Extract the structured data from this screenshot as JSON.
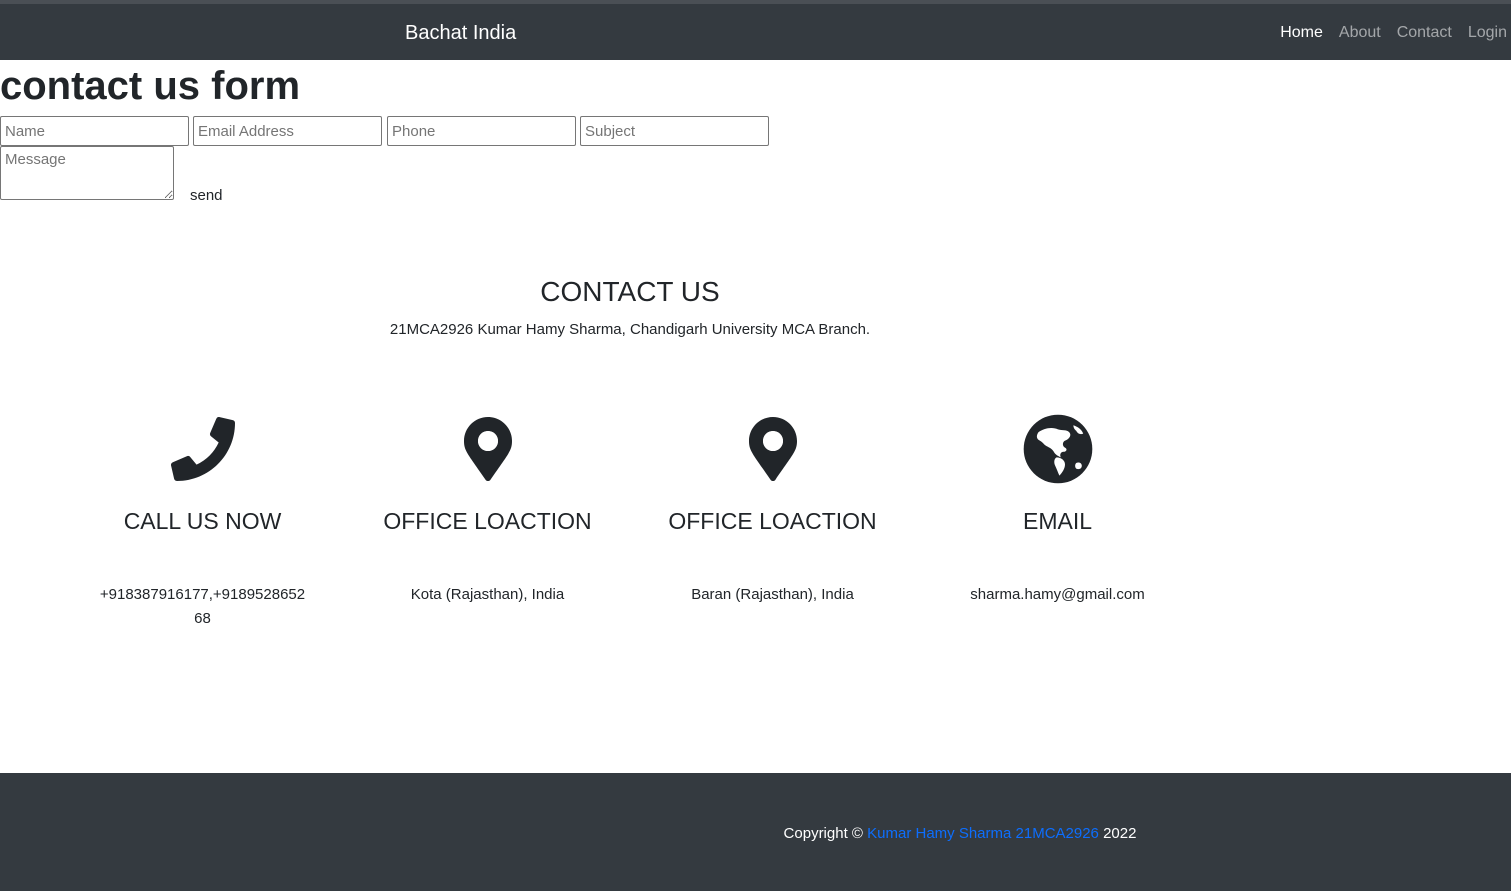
{
  "navbar": {
    "brand": "Bachat India",
    "links": [
      "Home",
      "About",
      "Contact",
      "Login"
    ]
  },
  "form": {
    "title": "contact us form",
    "name_placeholder": "Name",
    "email_placeholder": "Email Address",
    "phone_placeholder": "Phone",
    "subject_placeholder": "Subject",
    "message_placeholder": "Message",
    "send_label": "send"
  },
  "contact": {
    "heading": "CONTACT US",
    "address": "21MCA2926 Kumar Hamy Sharma, Chandigarh University MCA Branch."
  },
  "cards": [
    {
      "icon": "phone-icon",
      "title": "CALL US NOW",
      "text": "+918387916177,+918952865268"
    },
    {
      "icon": "map-marker-icon",
      "title": "OFFICE LOACTION",
      "text": "Kota (Rajasthan), India"
    },
    {
      "icon": "map-marker-icon",
      "title": "OFFICE LOACTION",
      "text": "Baran (Rajasthan), India"
    },
    {
      "icon": "globe-icon",
      "title": "EMAIL",
      "text": "sharma.hamy@gmail.com"
    }
  ],
  "footer": {
    "prefix": "Copyright ©",
    "link": "Kumar Hamy Sharma 21MCA2926",
    "year": "2022"
  },
  "colors": {
    "navbar_bg": "#343a40",
    "link": "#0d6efd",
    "text": "#212529"
  }
}
